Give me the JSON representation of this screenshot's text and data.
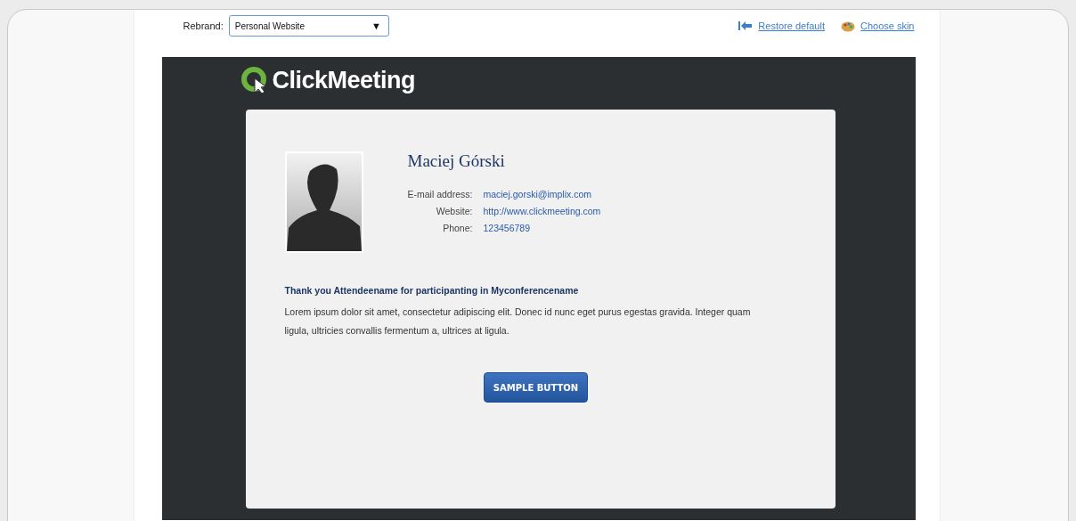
{
  "toolbar": {
    "rebrand_label": "Rebrand:",
    "rebrand_value": "Personal Website",
    "dropdown_caret": "▼",
    "links": [
      {
        "kind": "restore",
        "label": "Restore default"
      },
      {
        "kind": "skin",
        "label": "Choose skin"
      }
    ]
  },
  "preview": {
    "logo": "ClickMeeting",
    "profile": {
      "name": "Maciej Górski",
      "fields": [
        {
          "label": "E-mail address:",
          "value": "maciej.gorski@implix.com"
        },
        {
          "label": "Website:",
          "value": "http://www.clickmeeting.com"
        },
        {
          "label": "Phone:",
          "value": "123456789"
        }
      ]
    },
    "heading": "Thank you Attendeename for participanting in Myconferencename",
    "body": "Lorem ipsum dolor sit amet, consectetur adipiscing elit. Donec id nunc eget purus egestas gravida. Integer quam ligula, ultricies convallis fermentum a, ultrices at ligula.",
    "button": "SAMPLE BUTTON"
  }
}
